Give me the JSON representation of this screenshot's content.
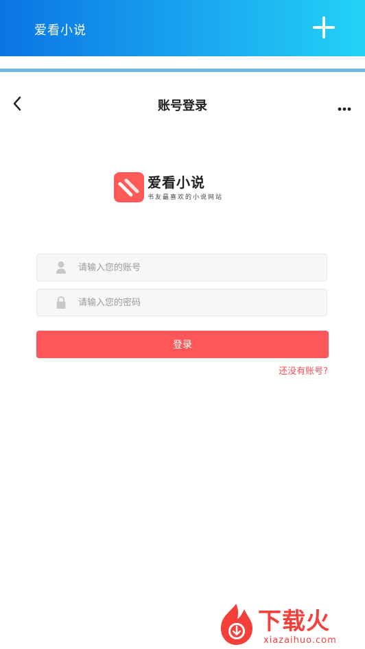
{
  "top_bar": {
    "title": "爱看小说",
    "add_icon": "plus-icon",
    "colors": {
      "from": "#0a74e4",
      "to": "#22d3f6"
    }
  },
  "nav": {
    "title": "账号登录",
    "back_icon": "chevron-left-icon",
    "more_icon": "more-dots-icon"
  },
  "logo": {
    "name": "爱看小说",
    "slogan": "书友最喜欢的小说网站",
    "color": "#ff5a58"
  },
  "form": {
    "username": {
      "placeholder": "请输入您的账号",
      "value": "",
      "icon": "user-icon"
    },
    "password": {
      "placeholder": "请输入您的密码",
      "value": "",
      "icon": "lock-icon"
    },
    "login_label": "登录",
    "register_label": "还没有账号?",
    "accent": "#fd5759"
  },
  "watermark": {
    "title": "下载火",
    "domain": "xiazaihuo.com",
    "color": "#f43f3b"
  }
}
